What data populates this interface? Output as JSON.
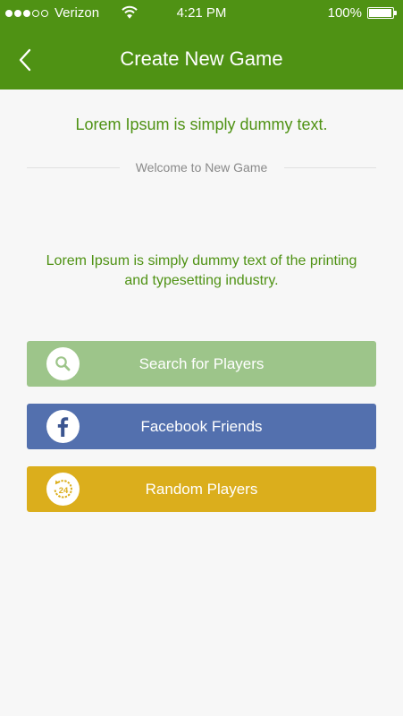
{
  "status_bar": {
    "carrier": "Verizon",
    "time": "4:21 PM",
    "battery": "100%",
    "battery_level": 1.0,
    "signal_bars_filled": 3,
    "signal_bars_total": 5
  },
  "header": {
    "title": "Create New Game",
    "back_icon": "chevron-left-icon",
    "background_color": "#4f9214"
  },
  "content": {
    "headline": "Lorem Ipsum is simply dummy text.",
    "divider_text": "Welcome to New Game",
    "description": "Lorem Ipsum is simply dummy text of the printing and typesetting industry."
  },
  "buttons": [
    {
      "label": "Search for Players",
      "icon": "search-icon",
      "color": "#9dc58a"
    },
    {
      "label": "Facebook Friends",
      "icon": "facebook-icon",
      "color": "#5370ae"
    },
    {
      "label": "Random Players",
      "icon": "random-24-icon",
      "color": "#dbae1c"
    }
  ],
  "colors": {
    "accent_green": "#4f9214",
    "background": "#f7f7f7"
  }
}
